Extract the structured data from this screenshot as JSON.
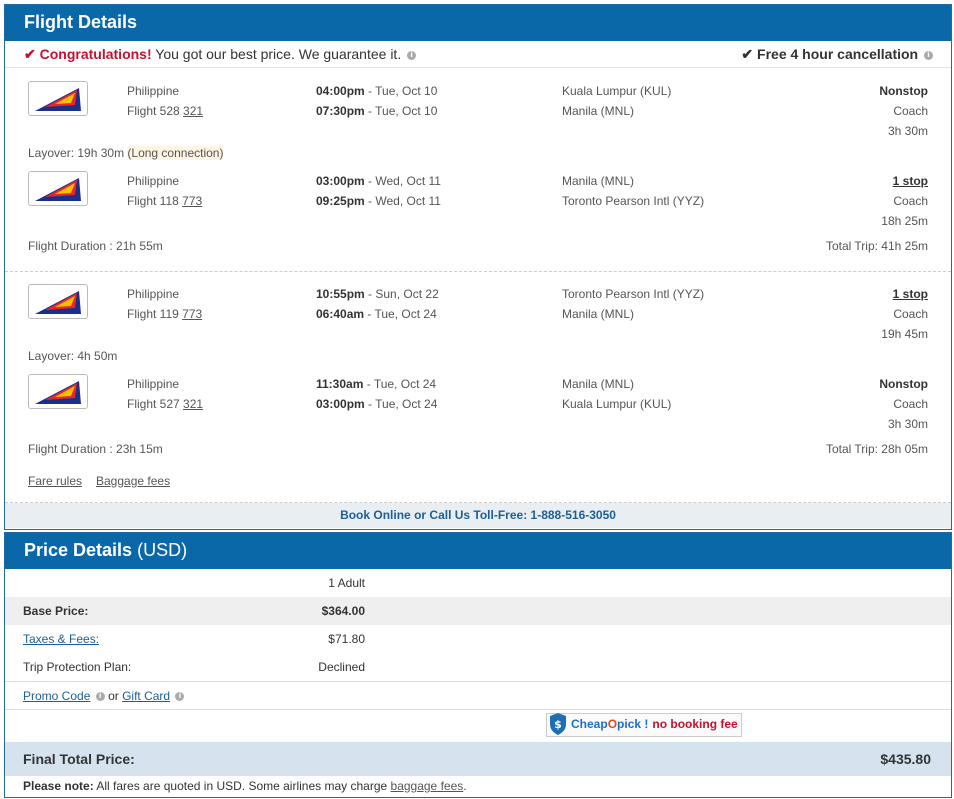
{
  "flight_details": {
    "title": "Flight Details",
    "congrats_strong": "Congratulations!",
    "congrats_text": "You got our best price. We guarantee it.",
    "cancellation": "Free 4 hour cancellation",
    "outbound": {
      "legs": [
        {
          "airline": "Philippine",
          "flight_prefix": "Flight 528",
          "aircraft": "321",
          "dep_time": "04:00pm",
          "dep_date": "Tue, Oct 10",
          "arr_time": "07:30pm",
          "arr_date": "Tue, Oct 10",
          "from": "Kuala Lumpur (KUL)",
          "to": "Manila (MNL)",
          "stops": "Nonstop",
          "cabin": "Coach",
          "duration": "3h 30m"
        },
        {
          "airline": "Philippine",
          "flight_prefix": "Flight 118",
          "aircraft": "773",
          "dep_time": "03:00pm",
          "dep_date": "Wed, Oct 11",
          "arr_time": "09:25pm",
          "arr_date": "Wed, Oct 11",
          "from": "Manila (MNL)",
          "to": "Toronto Pearson Intl (YYZ)",
          "stops": "1 stop",
          "cabin": "Coach",
          "duration": "18h 25m"
        }
      ],
      "layover_prefix": "Layover: 19h 30m ",
      "layover_note": "(Long connection)",
      "flight_duration": "Flight Duration : 21h 55m",
      "total_trip": "Total Trip: 41h 25m"
    },
    "return": {
      "legs": [
        {
          "airline": "Philippine",
          "flight_prefix": "Flight 119",
          "aircraft": "773",
          "dep_time": "10:55pm",
          "dep_date": "Sun, Oct 22",
          "arr_time": "06:40am",
          "arr_date": "Tue, Oct 24",
          "from": "Toronto Pearson Intl (YYZ)",
          "to": "Manila (MNL)",
          "stops": "1 stop",
          "cabin": "Coach",
          "duration": "19h 45m"
        },
        {
          "airline": "Philippine",
          "flight_prefix": "Flight 527",
          "aircraft": "321",
          "dep_time": "11:30am",
          "dep_date": "Tue, Oct 24",
          "arr_time": "03:00pm",
          "arr_date": "Tue, Oct 24",
          "from": "Manila (MNL)",
          "to": "Kuala Lumpur (KUL)",
          "stops": "Nonstop",
          "cabin": "Coach",
          "duration": "3h 30m"
        }
      ],
      "layover_prefix": "Layover: 4h 50m",
      "flight_duration": "Flight Duration : 23h 15m",
      "total_trip": "Total Trip: 28h 05m"
    },
    "fare_rules": "Fare rules",
    "baggage_fees": "Baggage fees",
    "book_online": "Book Online or Call Us Toll-Free: 1-888-516-3050"
  },
  "price_details": {
    "title": "Price Details",
    "currency": "(USD)",
    "passengers": "1 Adult",
    "base_label": "Base Price:",
    "base_value": "$364.00",
    "taxes_label": "Taxes & Fees:",
    "taxes_value": "$71.80",
    "protection_label": "Trip Protection Plan:",
    "protection_value": "Declined",
    "promo_code": "Promo Code",
    "or_text": "or",
    "gift_card": "Gift Card",
    "badge_cheap": "Cheap",
    "badge_o": "O",
    "badge_pick": "pick !",
    "badge_fee": "no booking fee",
    "final_label": "Final Total Price:",
    "final_value": "$435.80",
    "note_strong": "Please note:",
    "note_text": "All fares are quoted in USD. Some airlines may charge ",
    "note_link": "baggage fees",
    "note_end": "."
  },
  "colors": {
    "header": "#0a68a8",
    "accent_red": "#c8102e",
    "final_bg": "#d6e3ee"
  },
  "icons": [
    "check-icon",
    "info-icon",
    "airline-logo",
    "shield-icon"
  ]
}
